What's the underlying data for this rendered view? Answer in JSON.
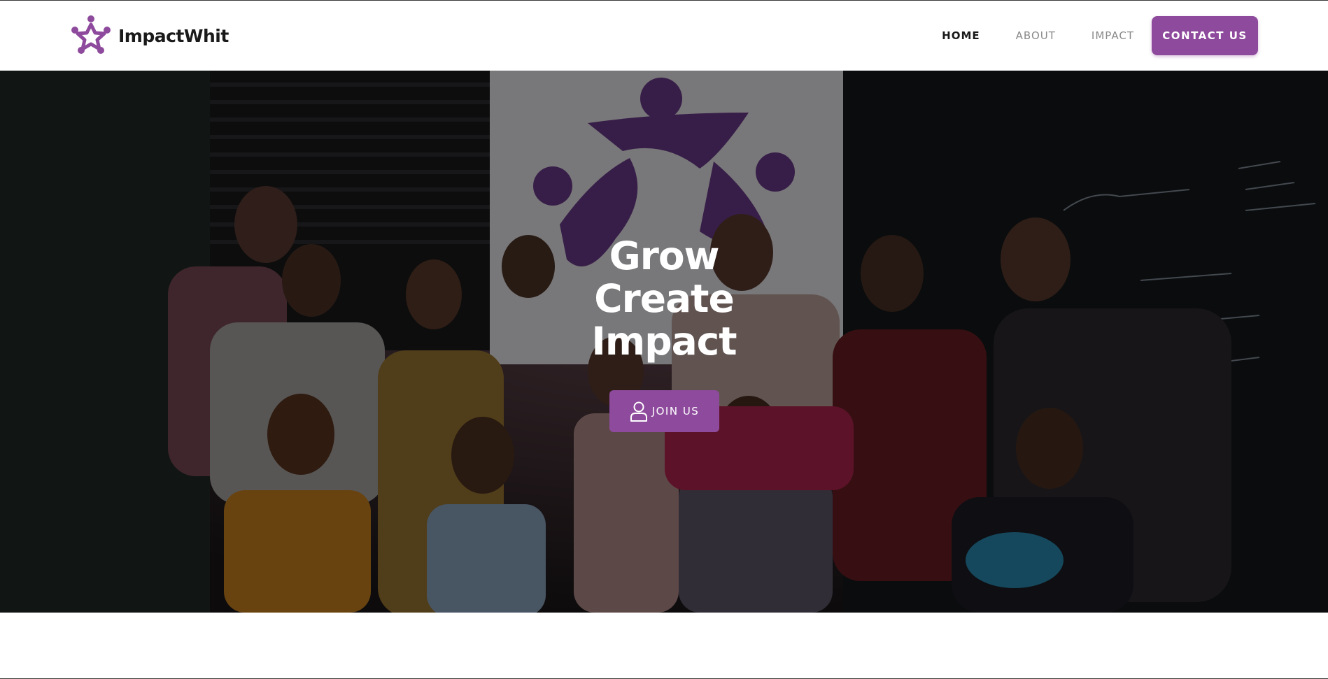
{
  "brand": {
    "name": "ImpactWhit",
    "logo_icon": "people-star-logo-icon",
    "color": "#8e4a9c"
  },
  "nav": {
    "items": [
      {
        "label": "HOME",
        "active": true
      },
      {
        "label": "ABOUT",
        "active": false
      },
      {
        "label": "IMPACT",
        "active": false
      }
    ],
    "contact_label": "CONTACT US"
  },
  "hero": {
    "lines": [
      "Grow",
      "Create",
      "Impact"
    ],
    "join_label": "JOIN US",
    "join_icon": "user-icon",
    "background": "group-photo"
  },
  "colors": {
    "accent": "#8e4a9c",
    "text_dark": "#1a1a1a",
    "nav_muted": "#8a8a8a"
  }
}
